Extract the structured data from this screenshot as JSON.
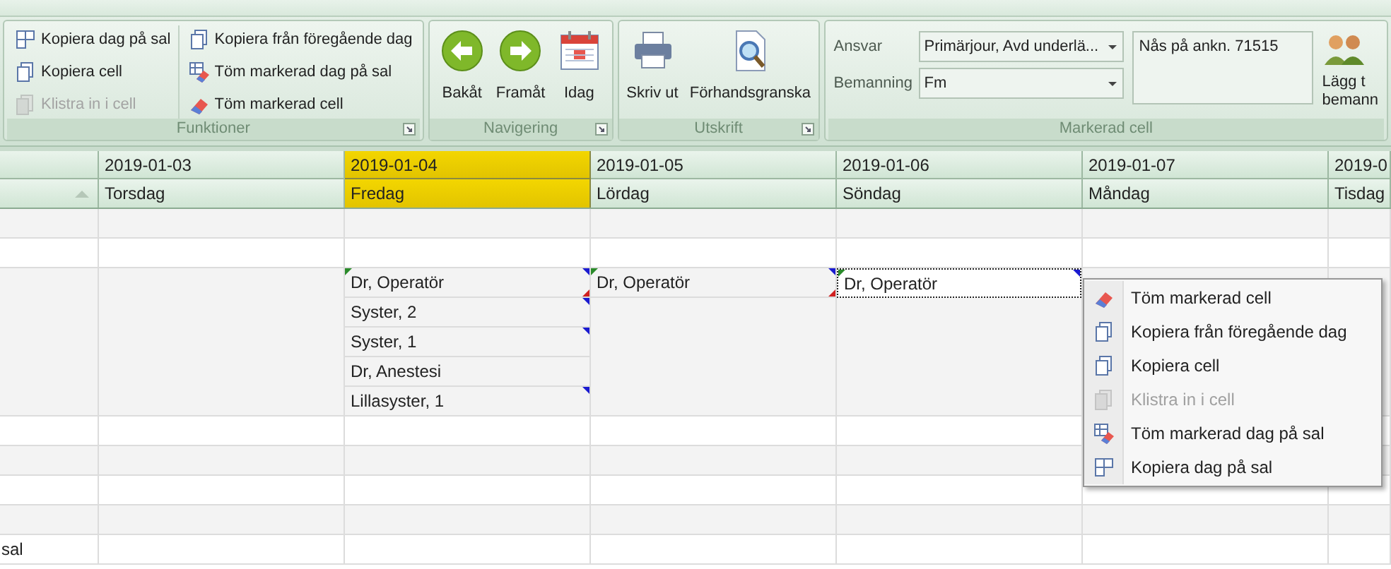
{
  "ribbon": {
    "functions": {
      "label": "Funktioner",
      "columns": [
        [
          {
            "label": "Kopiera dag på sal",
            "disabled": false
          },
          {
            "label": "Kopiera cell",
            "disabled": false
          },
          {
            "label": "Klistra in i cell",
            "disabled": true
          }
        ],
        [
          {
            "label": "Kopiera från föregående dag",
            "disabled": false
          },
          {
            "label": "Töm markerad dag på sal",
            "disabled": false
          },
          {
            "label": "Töm markerad cell",
            "disabled": false
          }
        ]
      ]
    },
    "navigation": {
      "label": "Navigering",
      "buttons": [
        "Bakåt",
        "Framåt",
        "Idag"
      ]
    },
    "print": {
      "label": "Utskrift",
      "buttons": [
        "Skriv ut",
        "Förhandsgranska"
      ]
    },
    "selected_cell": {
      "label": "Markerad cell",
      "fields": [
        {
          "label": "Ansvar",
          "value": "Primärjour, Avd underlä..."
        },
        {
          "label": "Bemanning",
          "value": "Fm"
        }
      ],
      "note": "Nås på ankn. 71515",
      "add_button": [
        "Lägg t",
        "bemann"
      ]
    }
  },
  "grid": {
    "columns": [
      {
        "date": "2019-01-03",
        "day": "Torsdag",
        "selected": false
      },
      {
        "date": "2019-01-04",
        "day": "Fredag",
        "selected": true
      },
      {
        "date": "2019-01-05",
        "day": "Lördag",
        "selected": false
      },
      {
        "date": "2019-01-06",
        "day": "Söndag",
        "selected": false
      },
      {
        "date": "2019-01-07",
        "day": "Måndag",
        "selected": false
      },
      {
        "date": "2019-0",
        "day": "Tisdag",
        "selected": false
      }
    ],
    "rows": [
      {},
      {},
      {
        "cells": [
          {},
          {
            "entries": [
              {
                "text": "Dr, Operatör",
                "green_corner": true,
                "blue_corner": true,
                "red_corner": true,
                "selected": false
              },
              {
                "text": "Syster, 2",
                "green_corner": false,
                "blue_corner": true,
                "red_corner": false,
                "selected": false
              },
              {
                "text": "Syster, 1",
                "green_corner": false,
                "blue_corner": true,
                "red_corner": false,
                "selected": false
              },
              {
                "text": "Dr, Anestesi",
                "green_corner": false,
                "blue_corner": false,
                "red_corner": false,
                "selected": false
              },
              {
                "text": "Lillasyster, 1",
                "green_corner": false,
                "blue_corner": true,
                "red_corner": false,
                "selected": false
              }
            ]
          },
          {
            "entries": [
              {
                "text": "Dr, Operatör",
                "green_corner": true,
                "blue_corner": true,
                "red_corner": true,
                "selected": false
              }
            ]
          },
          {
            "entries": [
              {
                "text": "Dr, Operatör",
                "green_corner": true,
                "blue_corner": true,
                "red_corner": false,
                "selected": true
              }
            ]
          },
          {},
          {}
        ]
      },
      {},
      {},
      {},
      {},
      {
        "label": "sal"
      }
    ]
  },
  "context_menu": {
    "items": [
      {
        "label": "Töm markerad cell",
        "disabled": false
      },
      {
        "label": "Kopiera från föregående dag",
        "disabled": false
      },
      {
        "label": "Kopiera cell",
        "disabled": false
      },
      {
        "label": "Klistra in i cell",
        "disabled": true
      },
      {
        "label": "Töm markerad dag på sal",
        "disabled": false
      },
      {
        "label": "Kopiera dag på sal",
        "disabled": false
      }
    ]
  }
}
